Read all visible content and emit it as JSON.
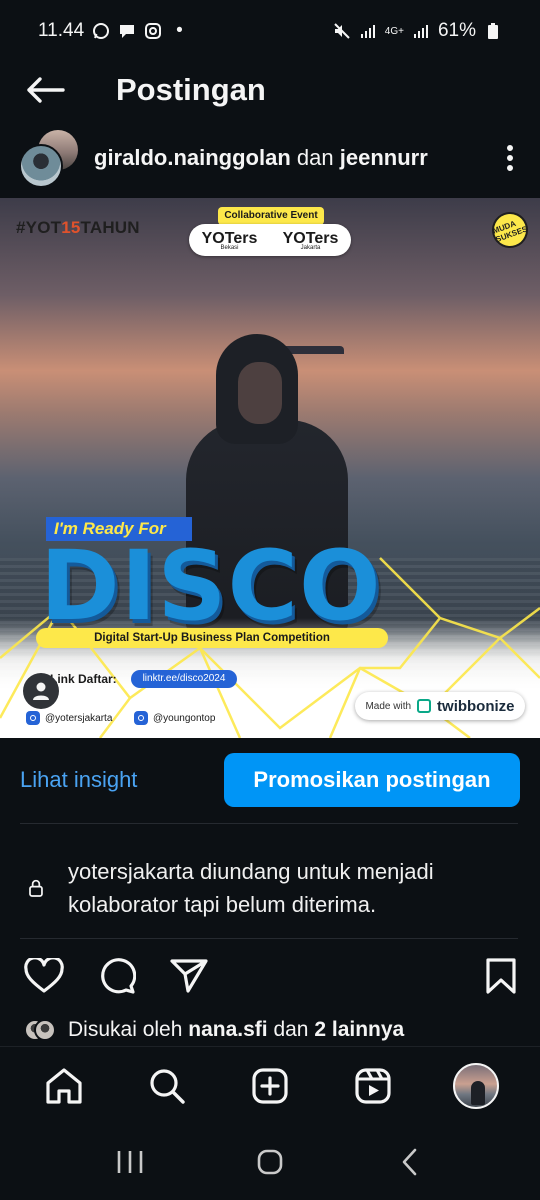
{
  "status_bar": {
    "time": "11.44",
    "dot": "•",
    "network": "4G+",
    "battery": "61%"
  },
  "header": {
    "title": "Postingan"
  },
  "post": {
    "user1": "giraldo.nainggolan",
    "joiner": "dan",
    "user2": "jeennurr"
  },
  "image": {
    "hashtag_prefix": "#YOT",
    "hashtag_num": "15",
    "hashtag_suffix": "TAHUN",
    "collab_label": "Collaborative Event",
    "logo1": "YOTers",
    "logo1_sub": "Bekasi",
    "logo2": "YOTers",
    "logo2_sub": "Jakarta",
    "badge": "MUDA SUKSES",
    "ready": "I'm Ready For",
    "disco": "DISCO",
    "competition": "Digital Start-Up Business Plan Competition",
    "link_label": "Link Daftar:",
    "link_url": "linktr.ee/disco2024",
    "ig1": "@yotersjakarta",
    "ig2": "@youngontop",
    "made_with": "Made with",
    "made_brand": "twibbonize"
  },
  "actions": {
    "insight": "Lihat insight",
    "promote": "Promosikan postingan"
  },
  "notice": {
    "text": "yotersjakarta diundang untuk menjadi kolaborator tapi belum diterima."
  },
  "likes": {
    "prefix": "Disukai oleh",
    "user": "nana.sfi",
    "joiner": "dan",
    "others": "2 lainnya"
  },
  "colors": {
    "background": "#0c1014",
    "accent": "#0095f6",
    "link": "#4aa3f2"
  },
  "icons": {
    "back": "arrow-left-icon",
    "more": "more-vertical-icon",
    "like": "heart-icon",
    "comment": "comment-icon",
    "share": "send-icon",
    "save": "bookmark-icon",
    "home": "home-icon",
    "search": "search-icon",
    "create": "plus-square-icon",
    "reels": "reels-icon"
  }
}
